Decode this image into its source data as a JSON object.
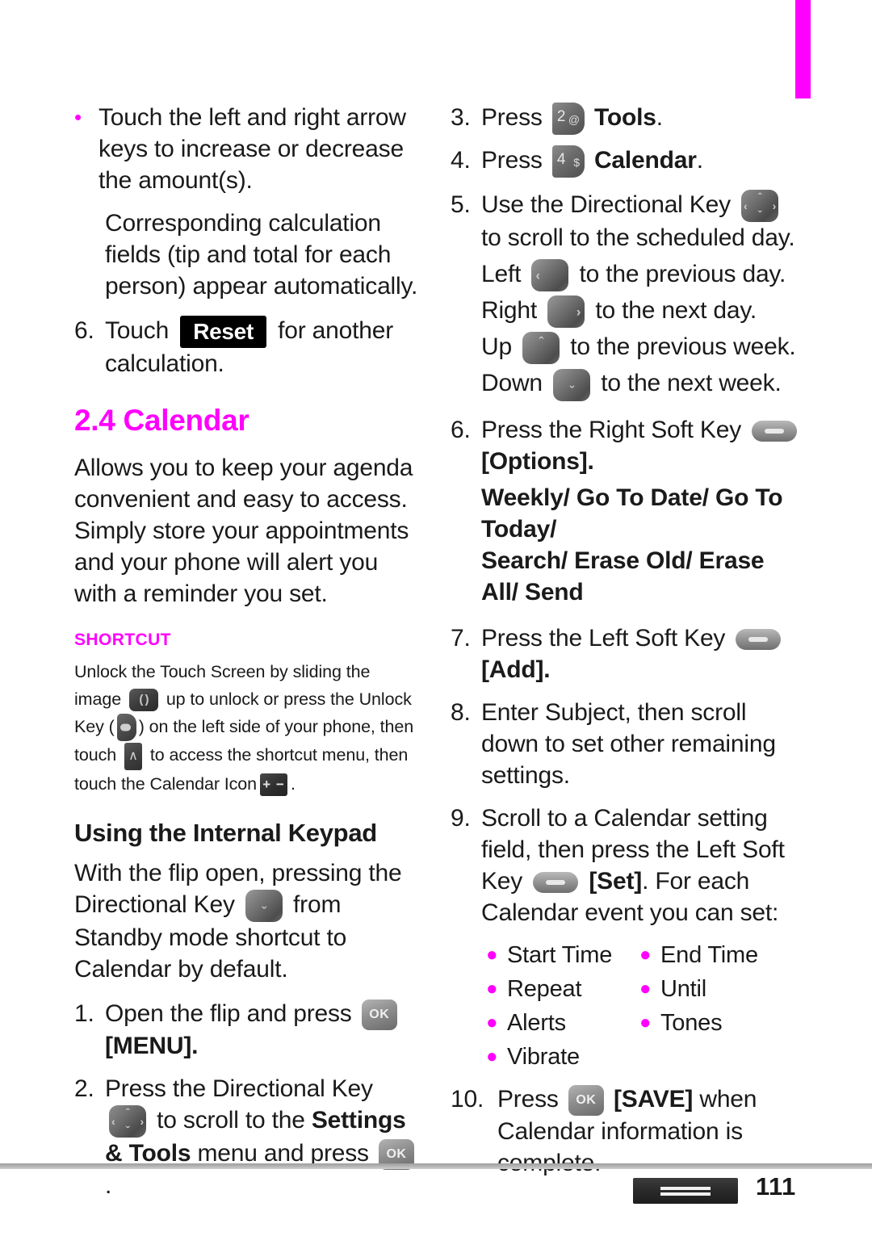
{
  "page": {
    "number": "111",
    "accent_color": "#ff00ff",
    "edge_tab_color": "#ff00ff"
  },
  "left_column": {
    "bullet_1": {
      "marker": "•",
      "text": "Touch the left and right arrow keys to increase or decrease the amount(s)."
    },
    "paragraph_1": "Corresponding calculation fields (tip and total for each person) appear automatically.",
    "step_6": {
      "marker": "6.",
      "text_before": "Touch",
      "chip_label": "Reset",
      "text_after": "for another calculation."
    },
    "section_heading": "2.4 Calendar",
    "section_intro": "Allows you to keep your agenda convenient and easy to access. Simply store your appointments and your phone will alert you with a reminder you set.",
    "shortcut": {
      "heading": "SHORTCUT",
      "text_1": "Unlock the Touch Screen by sliding the image",
      "icon_1_name": "unlock-slider-icon",
      "icon_1_glyph": "( )",
      "text_2": "up to unlock or press the Unlock Key (",
      "icon_2_name": "unlock-key-icon",
      "text_3": ")",
      "text_4": "on the left side of your phone, then touch",
      "icon_3_name": "caret-up-icon",
      "icon_3_glyph": "∧",
      "text_5": "to",
      "text_6": "access the shortcut menu, then touch the",
      "text_7": "Calendar Icon",
      "icon_4_name": "calendar-shortcut-icon",
      "icon_4_glyph": "+ −",
      "text_8": "."
    },
    "keypad": {
      "heading": "Using the Internal Keypad",
      "intro_before": "With the flip open, pressing the Directional Key",
      "intro_after": "from Standby mode shortcut to Calendar by default.",
      "step_1": {
        "marker": "1.",
        "text_before": "Open the flip and press",
        "key_label": "OK",
        "text_after": "[MENU]."
      },
      "step_2": {
        "marker": "2.",
        "text_before": "Press the Directional Key",
        "text_mid": "to scroll to the",
        "bold_menu": "Settings & Tools",
        "text_after": "menu and press",
        "key_label": "OK",
        "text_end": "."
      }
    }
  },
  "right_column": {
    "step_3": {
      "marker": "3.",
      "text_before": "Press",
      "key_digit": "2",
      "key_symbol": "@",
      "bold_label": "Tools",
      "text_after": "."
    },
    "step_4": {
      "marker": "4.",
      "text_before": "Press",
      "key_digit": "4",
      "key_symbol": "$",
      "bold_label": "Calendar",
      "text_after": "."
    },
    "step_5": {
      "marker": "5.",
      "text_before": "Use the Directional Key",
      "text_after": "to scroll to the scheduled day.",
      "directions": [
        {
          "label": "Left",
          "icon": "arrow-left-key-icon",
          "glyph": "‹",
          "text": "to the previous day."
        },
        {
          "label": "Right",
          "icon": "arrow-right-key-icon",
          "glyph": "›",
          "text": "to the next day."
        },
        {
          "label": "Up",
          "icon": "arrow-up-key-icon",
          "glyph": "ˆ",
          "text": "to the previous week."
        },
        {
          "label": "Down",
          "icon": "arrow-down-key-icon",
          "glyph": "ˇ",
          "text": "to the next week."
        }
      ]
    },
    "step_6": {
      "marker": "6.",
      "text_before": "Press the Right Soft Key",
      "bold_bracket": "[Options].",
      "options_line_1": "Weekly/ Go To Date/ Go To Today/",
      "options_line_2": "Search/ Erase Old/ Erase All/ Send"
    },
    "step_7": {
      "marker": "7.",
      "text_before": "Press the Left Soft Key",
      "bold_bracket": "[Add]."
    },
    "step_8": {
      "marker": "8.",
      "text": "Enter Subject, then scroll down to set other remaining settings."
    },
    "step_9": {
      "marker": "9.",
      "text_before": "Scroll to a Calendar setting field, then press the Left Soft Key",
      "bold_bracket": "[Set]",
      "text_after": ". For each Calendar event you can set:"
    },
    "settings_rows": [
      {
        "left": "Start Time",
        "right": "End Time"
      },
      {
        "left": "Repeat",
        "right": "Until"
      },
      {
        "left": "Alerts",
        "right": "Tones"
      },
      {
        "left": "Vibrate",
        "right": ""
      }
    ],
    "step_10": {
      "marker": "10.",
      "text_before": "Press",
      "key_label": "OK",
      "bold_bracket": "[SAVE]",
      "text_after": "when Calendar information is complete."
    }
  }
}
